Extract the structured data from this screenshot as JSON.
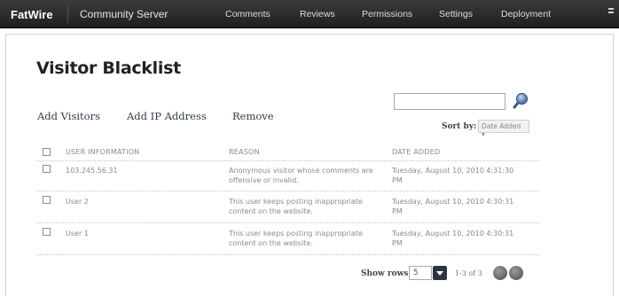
{
  "header": {
    "brand": "FatWire",
    "product": "Community Server",
    "nav": [
      "Comments",
      "Reviews",
      "Permissions",
      "Settings",
      "Deployment"
    ]
  },
  "page": {
    "title": "Visitor Blacklist"
  },
  "actions": {
    "add_visitors": "Add Visitors",
    "add_ip": "Add IP Address",
    "remove": "Remove"
  },
  "search": {
    "value": "",
    "placeholder": ""
  },
  "sort": {
    "label": "Sort by:",
    "value": "Date Added ▾"
  },
  "table": {
    "columns": [
      "USER INFORMATION",
      "REASON",
      "DATE ADDED"
    ],
    "rows": [
      {
        "user": "103.245.56.31",
        "reason": [
          "Anonymous visitor whose comments are",
          "offensive or invalid."
        ],
        "date": [
          "Tuesday, August 10, 2010 4:31:30",
          "PM"
        ]
      },
      {
        "user": "User 2",
        "reason": [
          "This user keeps posting inappropriate",
          "content on the website."
        ],
        "date": [
          "Tuesday, August 10, 2010 4:30:31",
          "PM"
        ]
      },
      {
        "user": "User 1",
        "reason": [
          "This user keeps posting inappropriate",
          "content on the website."
        ],
        "date": [
          "Tuesday, August 10, 2010 4:30:31",
          "PM"
        ]
      }
    ]
  },
  "pager": {
    "label": "Show rows:",
    "rows_value": "5",
    "range": "1-3 of 3"
  },
  "icons": {
    "search": "magnifier-icon",
    "menu": "menu-icon",
    "prev": "prev-page-icon",
    "next": "next-page-icon"
  }
}
